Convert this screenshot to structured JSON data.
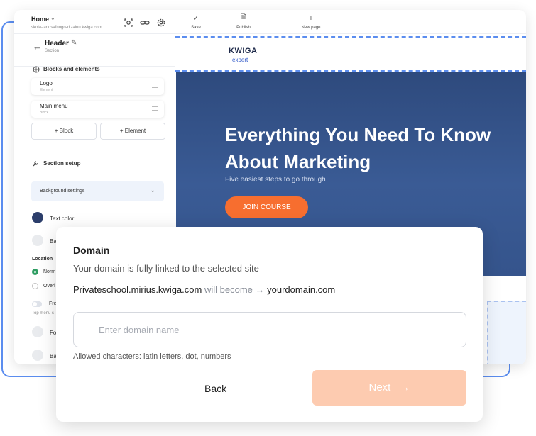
{
  "sidebar": {
    "home_title": "Home",
    "home_url": "skola-landsafnogo-dizainu.kwiga.com",
    "header_title": "Header",
    "header_sub": "Section",
    "blocks_label": "Blocks and elements",
    "elements": [
      {
        "title": "Logo",
        "sub": "Element"
      },
      {
        "title": "Main menu",
        "sub": "Block"
      }
    ],
    "add_block": "+ Block",
    "add_element": "+ Element",
    "section_setup": "Section setup",
    "background_settings": "Background settings",
    "text_color_label": "Text color",
    "text_color": "#2c3e6b",
    "partial_ba1": "Ba",
    "location_label": "Location",
    "normal_partial": "Norm",
    "overlay_partial": "Overl",
    "fre_partial": "Fre",
    "top_menu_partial": "Top menu s",
    "fo_partial": "Fo",
    "ba2_partial": "Ba"
  },
  "toolbar": {
    "save": "Save",
    "publish": "Publish",
    "new_page": "New page"
  },
  "canvas": {
    "logo_name": "KWIGA",
    "logo_sub": "expert",
    "hero_title": "Everything You Need To Know About Marketing",
    "hero_sub": "Five easiest steps to go through",
    "join_button": "JOIN COURSE"
  },
  "modal": {
    "title": "Domain",
    "description": "Your domain is fully linked to the selected site",
    "current_domain": "Privateschool.mirius.kwiga.com",
    "will_become": "will become",
    "arrow": "→",
    "new_domain": "yourdomain.com",
    "input_placeholder": "Enter domain name",
    "hint": "Allowed characters: latin letters, dot, numbers",
    "back": "Back",
    "next": "Next",
    "next_arrow": "→"
  },
  "colors": {
    "accent_blue": "#5b8def",
    "hero_bg": "#34528a",
    "join_orange": "#f76e2f",
    "next_disabled": "#fdcbb0",
    "radio_green": "#2e9d62"
  }
}
